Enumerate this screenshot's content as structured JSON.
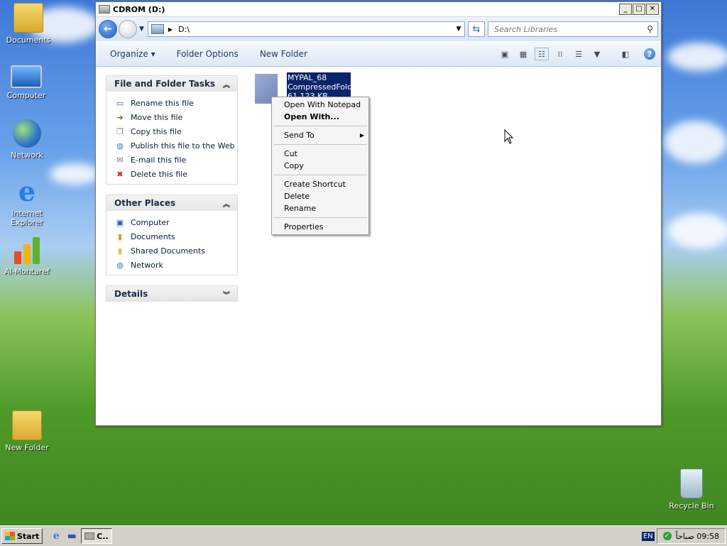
{
  "desktop": {
    "icons": [
      {
        "label": "Documents"
      },
      {
        "label": "Computer"
      },
      {
        "label": "Network"
      },
      {
        "label": "Internet Explorer"
      },
      {
        "label": "Al-Mohtaref"
      },
      {
        "label": "New Folder"
      },
      {
        "label": "Recycle Bin"
      }
    ]
  },
  "window": {
    "title": "CDROM (D:)",
    "controls": {
      "minimize": "_",
      "maximize": "□",
      "close": "✕"
    }
  },
  "address": {
    "path": "D:\\",
    "search_placeholder": "Search Libraries"
  },
  "toolbar": {
    "organize": "Organize ▾",
    "folder_options": "Folder Options",
    "new_folder": "New Folder"
  },
  "panels": {
    "file_tasks": {
      "title": "File and Folder Tasks",
      "items": [
        {
          "label": "Rename this file",
          "icon": "rename-icon"
        },
        {
          "label": "Move this file",
          "icon": "move-icon"
        },
        {
          "label": "Copy this file",
          "icon": "copy-icon"
        },
        {
          "label": "Publish this file to the Web",
          "icon": "publish-web-icon"
        },
        {
          "label": "E-mail this file",
          "icon": "email-icon"
        },
        {
          "label": "Delete this file",
          "icon": "delete-icon"
        }
      ]
    },
    "other_places": {
      "title": "Other Places",
      "items": [
        {
          "label": "Computer",
          "icon": "computer-icon"
        },
        {
          "label": "Documents",
          "icon": "documents-icon"
        },
        {
          "label": "Shared Documents",
          "icon": "shared-documents-icon"
        },
        {
          "label": "Network",
          "icon": "network-icon"
        }
      ]
    },
    "details": {
      "title": "Details"
    }
  },
  "file": {
    "name": "MYPAL_68",
    "type": "CompressedFolder",
    "size": "61,123 KB"
  },
  "context_menu": {
    "items": [
      {
        "label": "Open With Notepad",
        "bold": false
      },
      {
        "label": "Open With...",
        "bold": true
      },
      {
        "label": "Send To",
        "submenu": true
      },
      {
        "label": "Cut"
      },
      {
        "label": "Copy"
      },
      {
        "label": "Create Shortcut"
      },
      {
        "label": "Delete"
      },
      {
        "label": "Rename"
      },
      {
        "label": "Properties"
      }
    ]
  },
  "taskbar": {
    "start": "Start",
    "task_button": "C..",
    "language": "EN",
    "clock": "09:58 صباحاً"
  },
  "colors": {
    "selection": "#0a246a",
    "panel_title": "#1c2c48",
    "link_text": "#0b1d3a"
  }
}
